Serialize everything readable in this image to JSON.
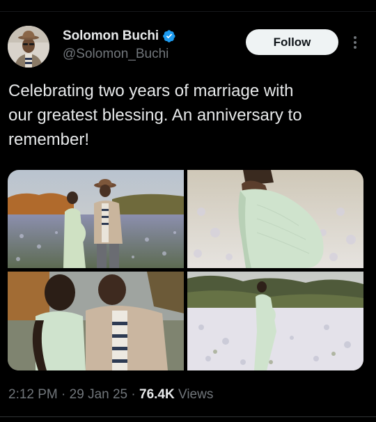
{
  "author": {
    "display_name": "Solomon Buchi",
    "handle": "@Solomon_Buchi",
    "verified": true
  },
  "actions": {
    "follow_label": "Follow"
  },
  "tweet": {
    "text": "Celebrating two years of marriage with\nour greatest blessing. An anniversary to\nremember!",
    "media": [
      {
        "icon": "photo-couple-standing-in-flower-field"
      },
      {
        "icon": "photo-woman-in-mint-dress-closeup"
      },
      {
        "icon": "photo-couple-kissing"
      },
      {
        "icon": "photo-woman-standing-in-flower-field"
      }
    ]
  },
  "meta": {
    "time": "2:12 PM",
    "sep1": " · ",
    "date": "29 Jan 25",
    "sep2": " · ",
    "views_count": "76.4K",
    "views_label": " Views"
  },
  "colors": {
    "background": "#000000",
    "primary_text": "#e7e9ea",
    "secondary_text": "#71767b",
    "verified_blue": "#1d9bf0",
    "follow_button_bg": "#eff3f4"
  }
}
